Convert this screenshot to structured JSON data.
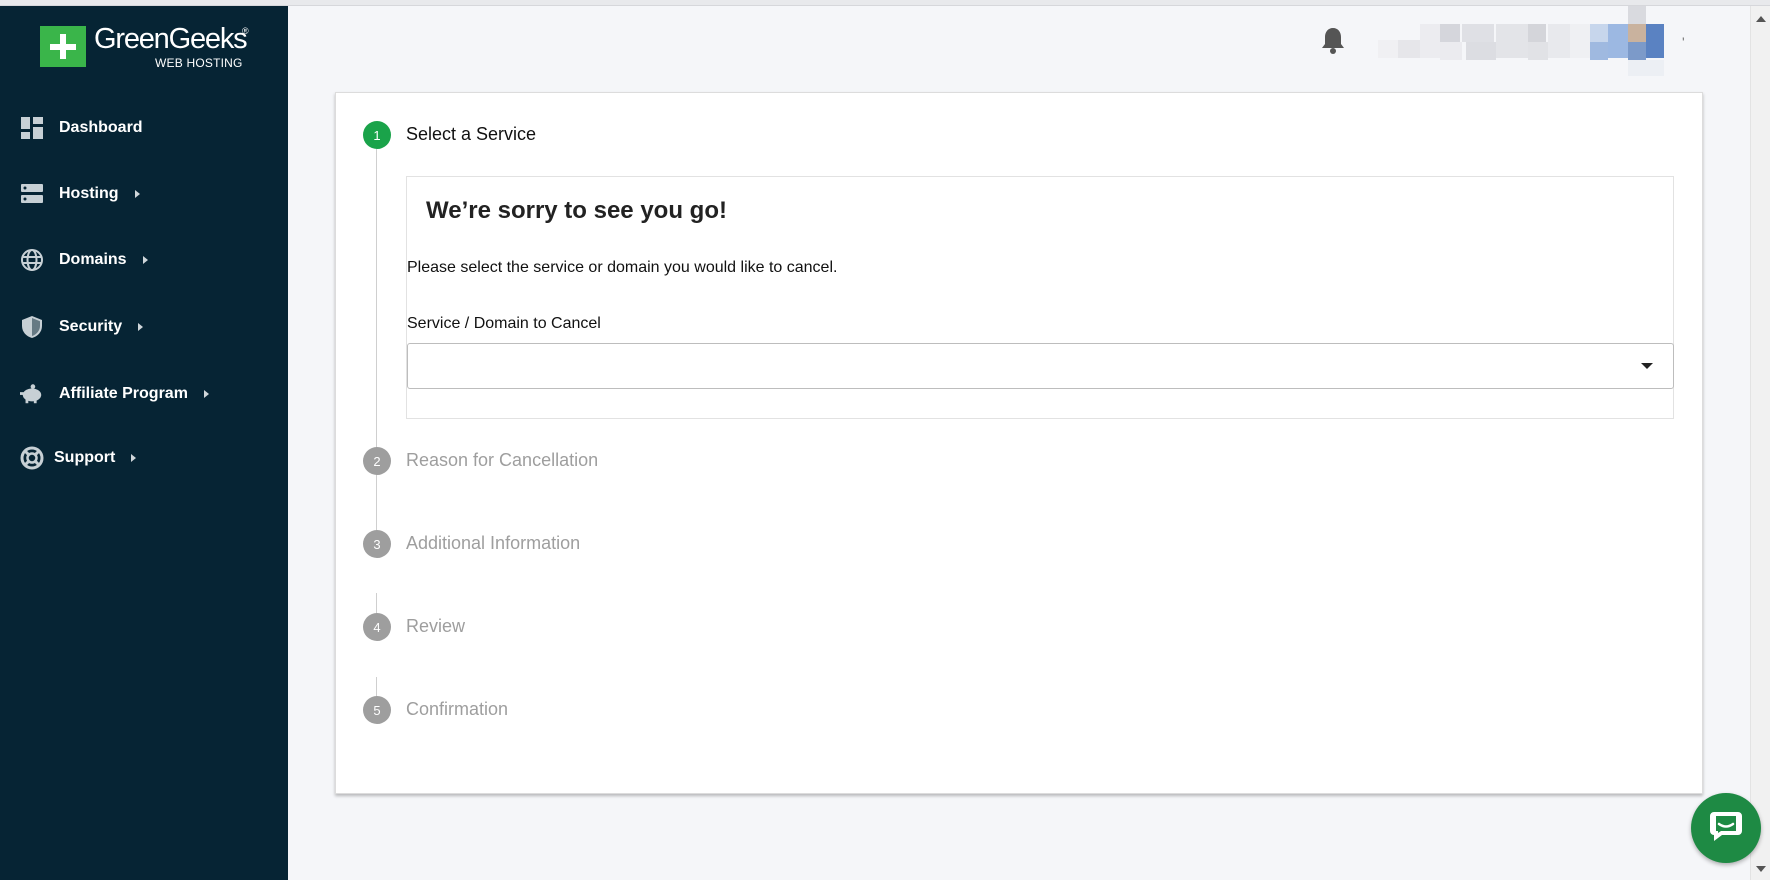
{
  "brand": {
    "name": "GreenGeeks",
    "registered": "®",
    "tagline": "WEB HOSTING"
  },
  "sidebar": {
    "items": [
      {
        "label": "Dashboard",
        "icon": "dashboard-icon",
        "has_submenu": false
      },
      {
        "label": "Hosting",
        "icon": "server-icon",
        "has_submenu": true
      },
      {
        "label": "Domains",
        "icon": "globe-icon",
        "has_submenu": true
      },
      {
        "label": "Security",
        "icon": "shield-icon",
        "has_submenu": true
      },
      {
        "label": "Affiliate Program",
        "icon": "piggy-bank-icon",
        "has_submenu": true
      },
      {
        "label": "Support",
        "icon": "lifebuoy-icon",
        "has_submenu": true
      }
    ]
  },
  "header": {
    "notification_icon": "bell-icon",
    "user_menu_mark": "'"
  },
  "wizard": {
    "steps": [
      {
        "number": "1",
        "label": "Select a Service",
        "state": "active"
      },
      {
        "number": "2",
        "label": "Reason for Cancellation",
        "state": "inactive"
      },
      {
        "number": "3",
        "label": "Additional Information",
        "state": "inactive"
      },
      {
        "number": "4",
        "label": "Review",
        "state": "inactive"
      },
      {
        "number": "5",
        "label": "Confirmation",
        "state": "inactive"
      }
    ],
    "panel": {
      "title": "We’re sorry to see you go!",
      "text": "Please select the service or domain you would like to cancel.",
      "field_label": "Service / Domain to Cancel",
      "field_value": ""
    }
  },
  "colors": {
    "sidebar_bg": "#062434",
    "accent_green": "#1aa34a",
    "chat_green": "#1e8a44",
    "inactive_gray": "#9e9e9e"
  },
  "chat": {
    "icon": "chat-icon"
  }
}
